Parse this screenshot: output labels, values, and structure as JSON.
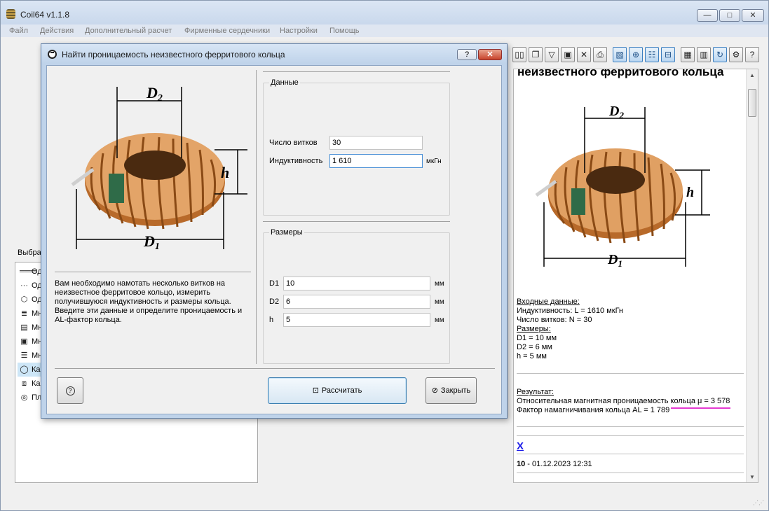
{
  "window": {
    "title": "Coil64 v1.1.8",
    "minimize": "—",
    "maximize": "□",
    "close": "✕"
  },
  "menu": [
    "Файл",
    "Действия",
    "Дополнительный расчет",
    "Фирменные сердечники",
    "Настройки",
    "Помощь"
  ],
  "left_panel": {
    "label": "Выбра",
    "items": [
      {
        "label": "Од",
        "icon": "single-layer-icon",
        "glyph": "═══"
      },
      {
        "label": "Од",
        "icon": "single-layer-pitch-icon",
        "glyph": "···"
      },
      {
        "label": "Од",
        "icon": "polygon-form-icon",
        "glyph": "⬡"
      },
      {
        "label": "Мн",
        "icon": "multilayer-icon",
        "glyph": "≣"
      },
      {
        "label": "Мн",
        "icon": "multilayer-gap-icon",
        "glyph": "▤"
      },
      {
        "label": "Мн",
        "icon": "multilayer-rect-icon",
        "glyph": "▣"
      },
      {
        "label": "Мн",
        "icon": "foil-icon",
        "glyph": "☰"
      },
      {
        "label": "Ка",
        "icon": "toroid-icon",
        "glyph": "◯",
        "selected": true
      },
      {
        "label": "Ка",
        "icon": "pot-core-icon",
        "glyph": "⧈"
      },
      {
        "label": "Пл",
        "icon": "spiral-icon",
        "glyph": "◎"
      }
    ]
  },
  "toolbar": [
    {
      "name": "columns-icon",
      "glyph": "▯▯",
      "blue": false
    },
    {
      "name": "copy-icon",
      "glyph": "❐",
      "blue": false
    },
    {
      "name": "paste-icon",
      "glyph": "▽",
      "blue": false
    },
    {
      "name": "save-icon",
      "glyph": "▣",
      "blue": false
    },
    {
      "name": "delete-icon",
      "glyph": "✕",
      "blue": false
    },
    {
      "name": "print-icon",
      "glyph": "⎙",
      "blue": false
    },
    {
      "name": "image-icon",
      "glyph": "▧",
      "blue": true
    },
    {
      "name": "add-icon",
      "glyph": "⊕",
      "blue": true
    },
    {
      "name": "list-icon",
      "glyph": "☷",
      "blue": true
    },
    {
      "name": "export-icon",
      "glyph": "⊟",
      "blue": true
    },
    {
      "name": "calendar-icon",
      "glyph": "▦",
      "blue": false
    },
    {
      "name": "clear-icon",
      "glyph": "▥",
      "blue": false
    },
    {
      "name": "refresh-icon",
      "glyph": "↻",
      "blue": true
    },
    {
      "name": "settings-icon",
      "glyph": "⚙",
      "blue": false
    },
    {
      "name": "help-icon",
      "glyph": "?",
      "blue": false
    }
  ],
  "dialog": {
    "title": "Найти проницаемость неизвестного ферритового кольца",
    "help_label": "?",
    "close_label": "✕",
    "description": "Вам необходимо намотать несколько витков на неизвестное ферритовое кольцо, измерить получившуюся индуктивность и размеры кольца. Введите эти данные и определите проницаемость и AL-фактор кольца.",
    "data_group": {
      "title": "Данные",
      "turns_label": "Число витков",
      "turns_value": "30",
      "inductance_label": "Индуктивность",
      "inductance_value": "1 610",
      "inductance_unit": "мкГн"
    },
    "size_group": {
      "title": "Размеры",
      "d1_label": "D1",
      "d1_value": "10",
      "d2_label": "D2",
      "d2_value": "6",
      "h_label": "h",
      "h_value": "5",
      "unit": "мм"
    },
    "help_button": "?",
    "calculate_button": "Рассчитать",
    "close_button": "Закрыть"
  },
  "diagram": {
    "d2": "D",
    "d2_sub": "2",
    "d1": "D",
    "d1_sub": "1",
    "h": "h"
  },
  "report": {
    "heading": "неизвестного ферритового кольца",
    "input_header": "Входные данные:",
    "inductance": "Индуктивность: L = 1610 мкГн",
    "turns": "Число витков: N = 30",
    "sizes_header": "Размеры:",
    "d1": "D1 = 10 мм",
    "d2": "D2 = 6 мм",
    "h": "h = 5 мм",
    "result_header": "Результат:",
    "permeability": "Относительная магнитная проницаемость кольца μ = 3 578",
    "al_factor": "Фактор намагничивания кольца AL = 1 789",
    "delete_link": "X",
    "entry_number": "10",
    "entry_date": " - 01.12.2023 12:31"
  }
}
